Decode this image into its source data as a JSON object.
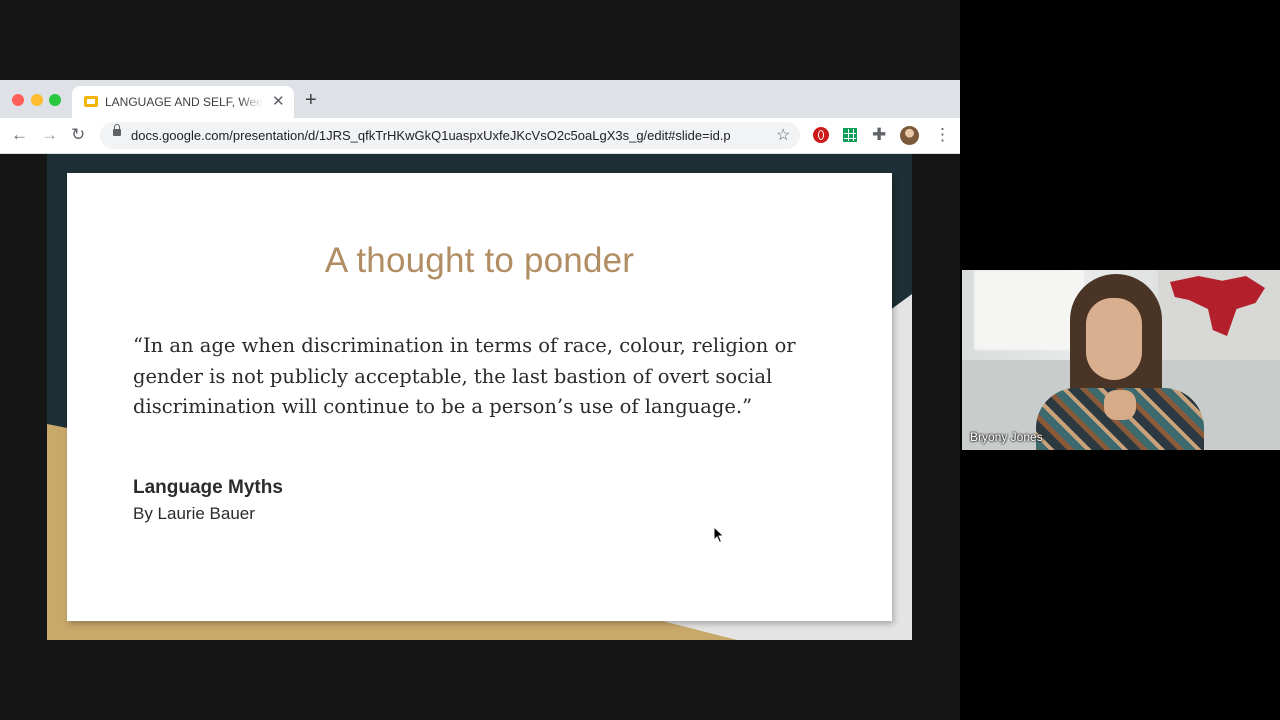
{
  "browser": {
    "tab_title": "LANGUAGE AND SELF, Weeks",
    "tab_close_icon": "close-icon",
    "new_tab_icon": "plus-icon",
    "url": "docs.google.com/presentation/d/1JRS_qfkTrHKwGkQ1uaspxUxfeJKcVsO2c5oaLgX3s_g/edit#slide=id.p",
    "traffic_lights": [
      "#ff5f57",
      "#febc2e",
      "#28c840"
    ],
    "nav_icons": [
      "back-arrow-icon",
      "forward-arrow-icon",
      "reload-icon"
    ],
    "extension_icons": [
      "opera-icon",
      "sheets-icon",
      "puzzle-icon",
      "profile-avatar",
      "menu-icon"
    ]
  },
  "slide": {
    "title": "A thought to ponder",
    "quote_lines": [
      "“In an age when discrimination in terms of race, colour, religion or",
      "gender is not publicly acceptable, the last bastion of overt social",
      "discrimination will continue to be a person’s use of language.”"
    ],
    "book_title": "Language Myths",
    "book_author": "By Laurie Bauer",
    "colors": {
      "title": "#b08d63",
      "dark_band": "#1f2f36",
      "gold_band": "#c9a96a"
    }
  },
  "video": {
    "participant_name": "Bryony Jones"
  }
}
